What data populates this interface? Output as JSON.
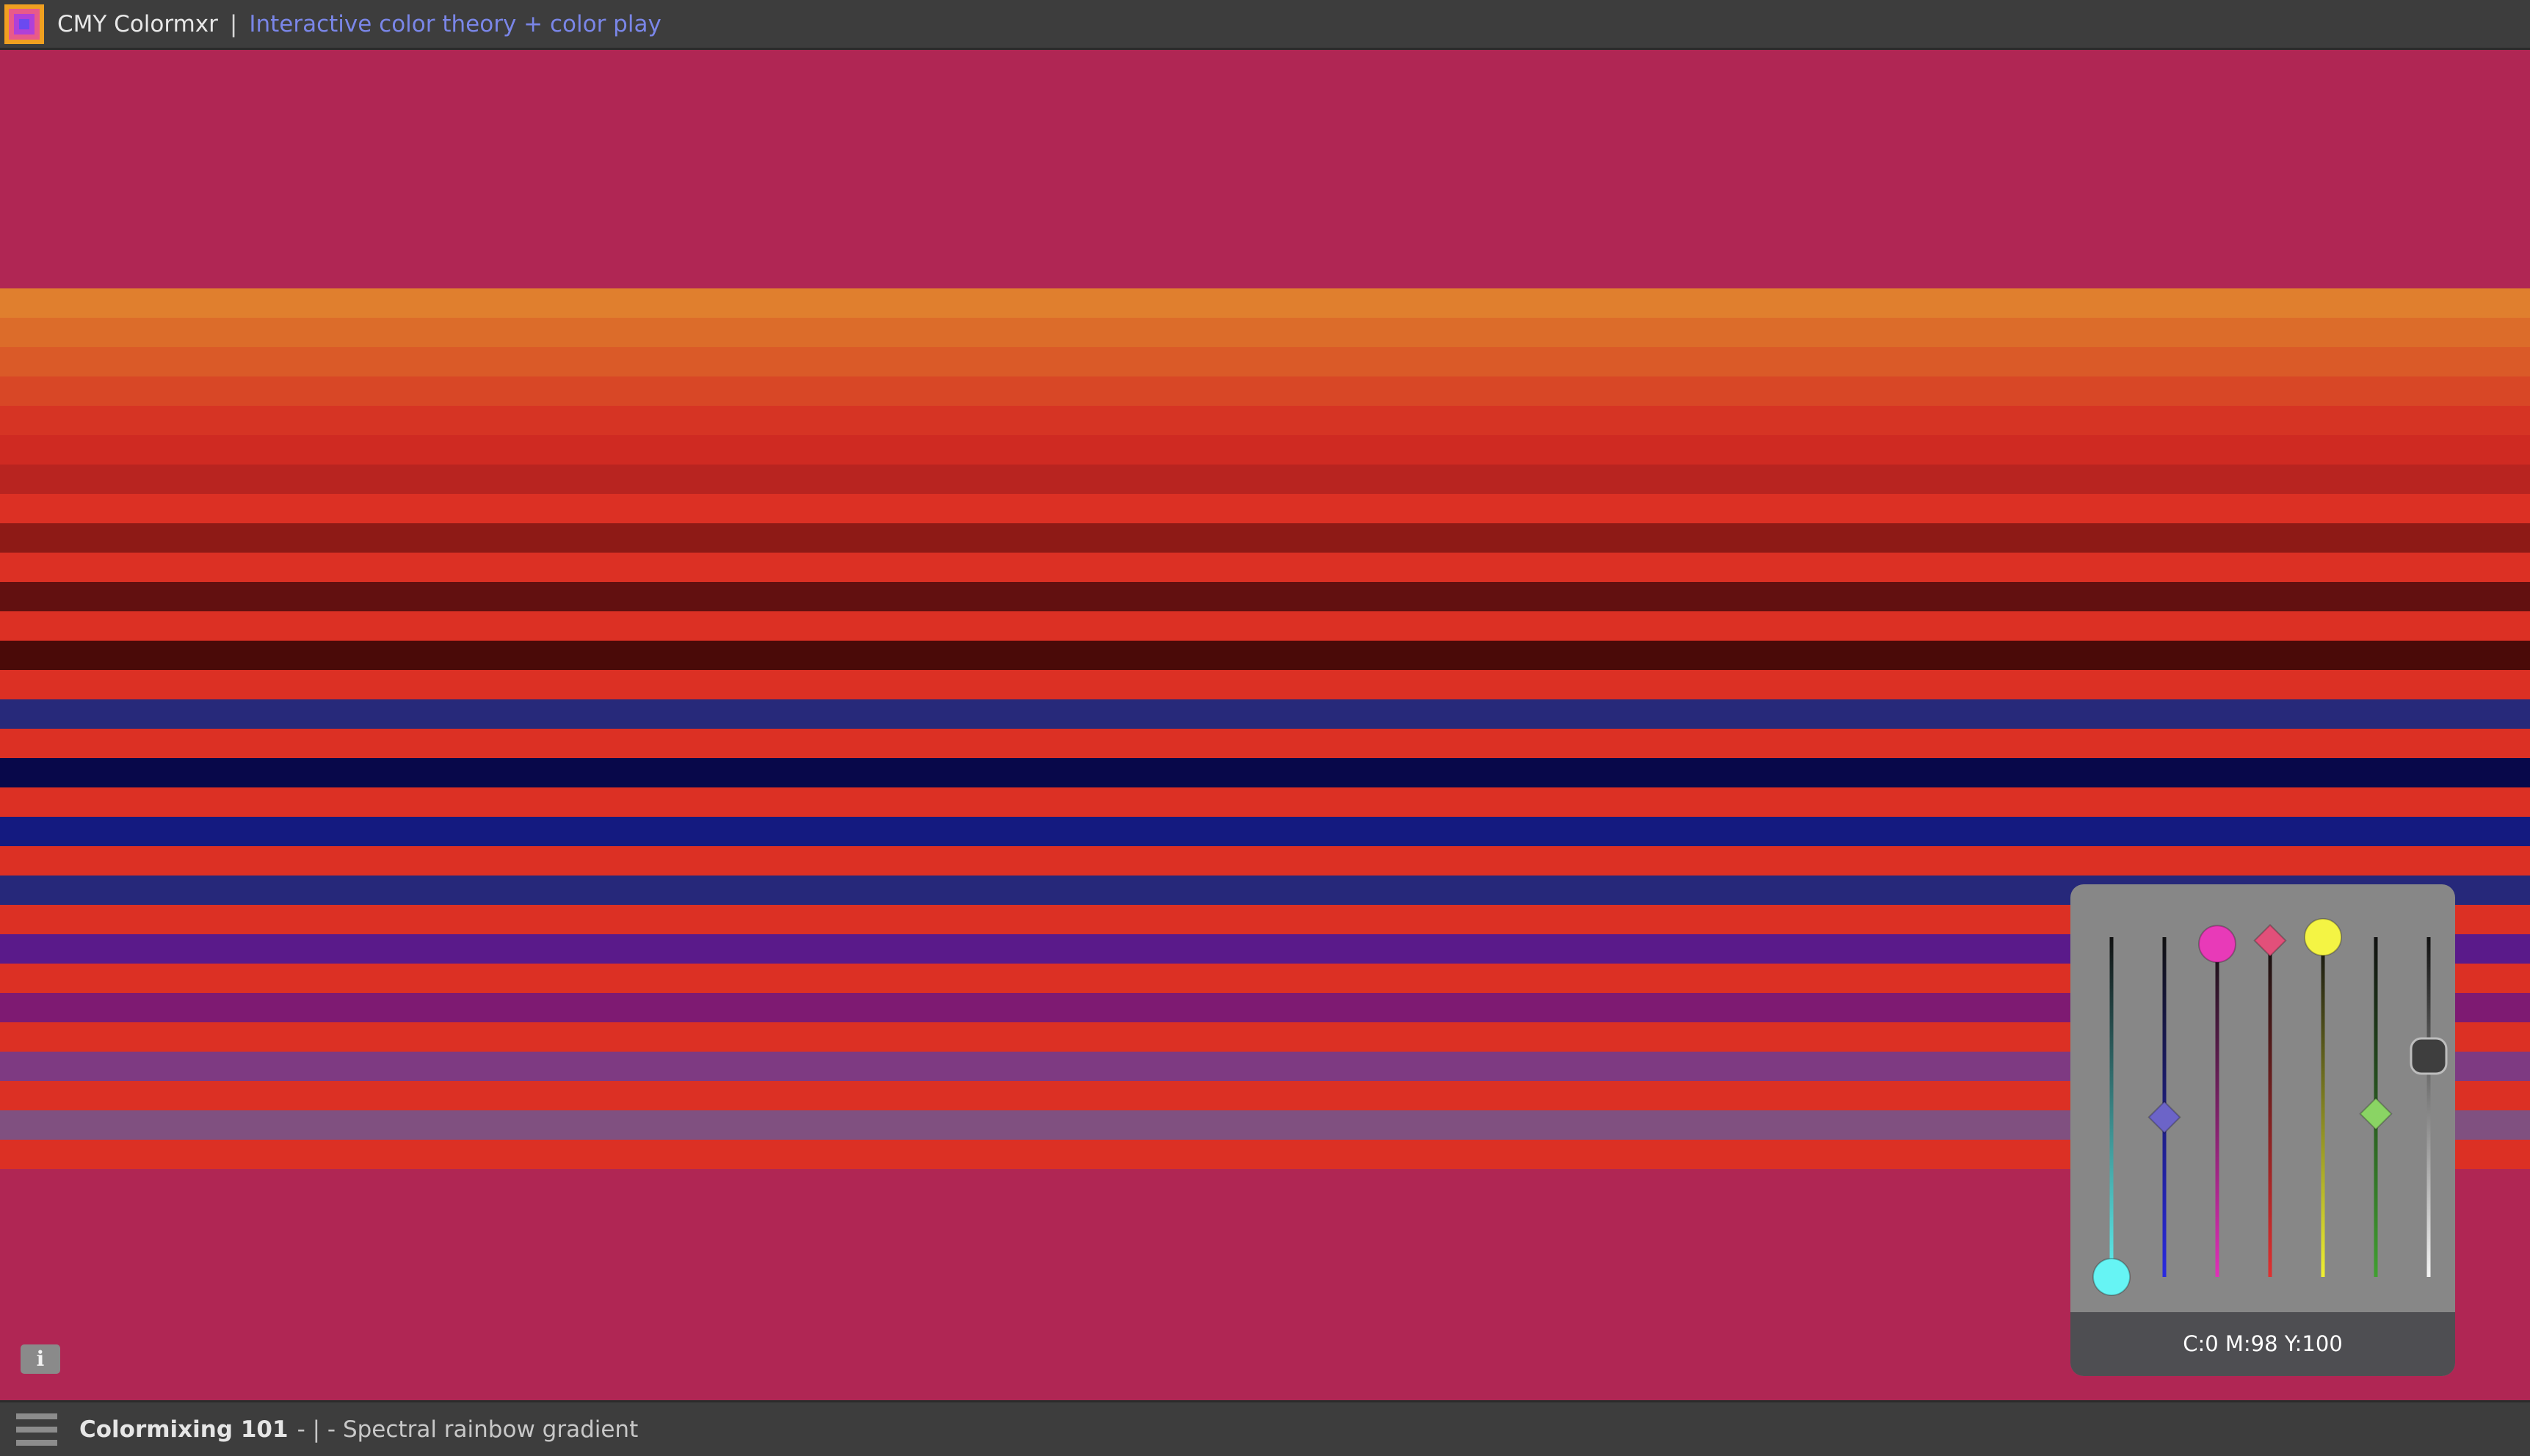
{
  "header": {
    "title": "CMY Colormxr",
    "separator": "|",
    "subtitle": "Interactive color theory + color play"
  },
  "canvas": {
    "background": "#b02654",
    "stripes": [
      "#e07f2e",
      "#dc6c2a",
      "#da5a28",
      "#d84726",
      "#d63424",
      "#cf2a22",
      "#b82420",
      "#dc3024",
      "#8e1a16",
      "#dc3024",
      "#621010",
      "#dc3024",
      "#4a0a08",
      "#dc3024",
      "#27297a",
      "#dc3024",
      "#08084a",
      "#dc3024",
      "#141a80",
      "#dc3024",
      "#26287a",
      "#dc3024",
      "#5a1a8a",
      "#dc3024",
      "#7e1a72",
      "#dc3024",
      "#7e3a82",
      "#dc3024",
      "#805080",
      "#dc3024"
    ]
  },
  "info_button": {
    "label": "i"
  },
  "sliders": {
    "readout": "C:0 M:98 Y:100",
    "cyan": {
      "value": 0,
      "color": "#66f4f4"
    },
    "blue": {
      "value": 47,
      "color": "#6c64c8"
    },
    "magenta": {
      "value": 98,
      "color": "#e83ab8"
    },
    "red": {
      "value": 99,
      "color": "#e2507a"
    },
    "yellow": {
      "value": 100,
      "color": "#f4f444"
    },
    "green": {
      "value": 48,
      "color": "#8ad464"
    },
    "gray": {
      "value": 65,
      "color": "#3e3e3e"
    }
  },
  "statusbar": {
    "title": "Colormixing 101",
    "description": "- | - Spectral rainbow gradient"
  }
}
